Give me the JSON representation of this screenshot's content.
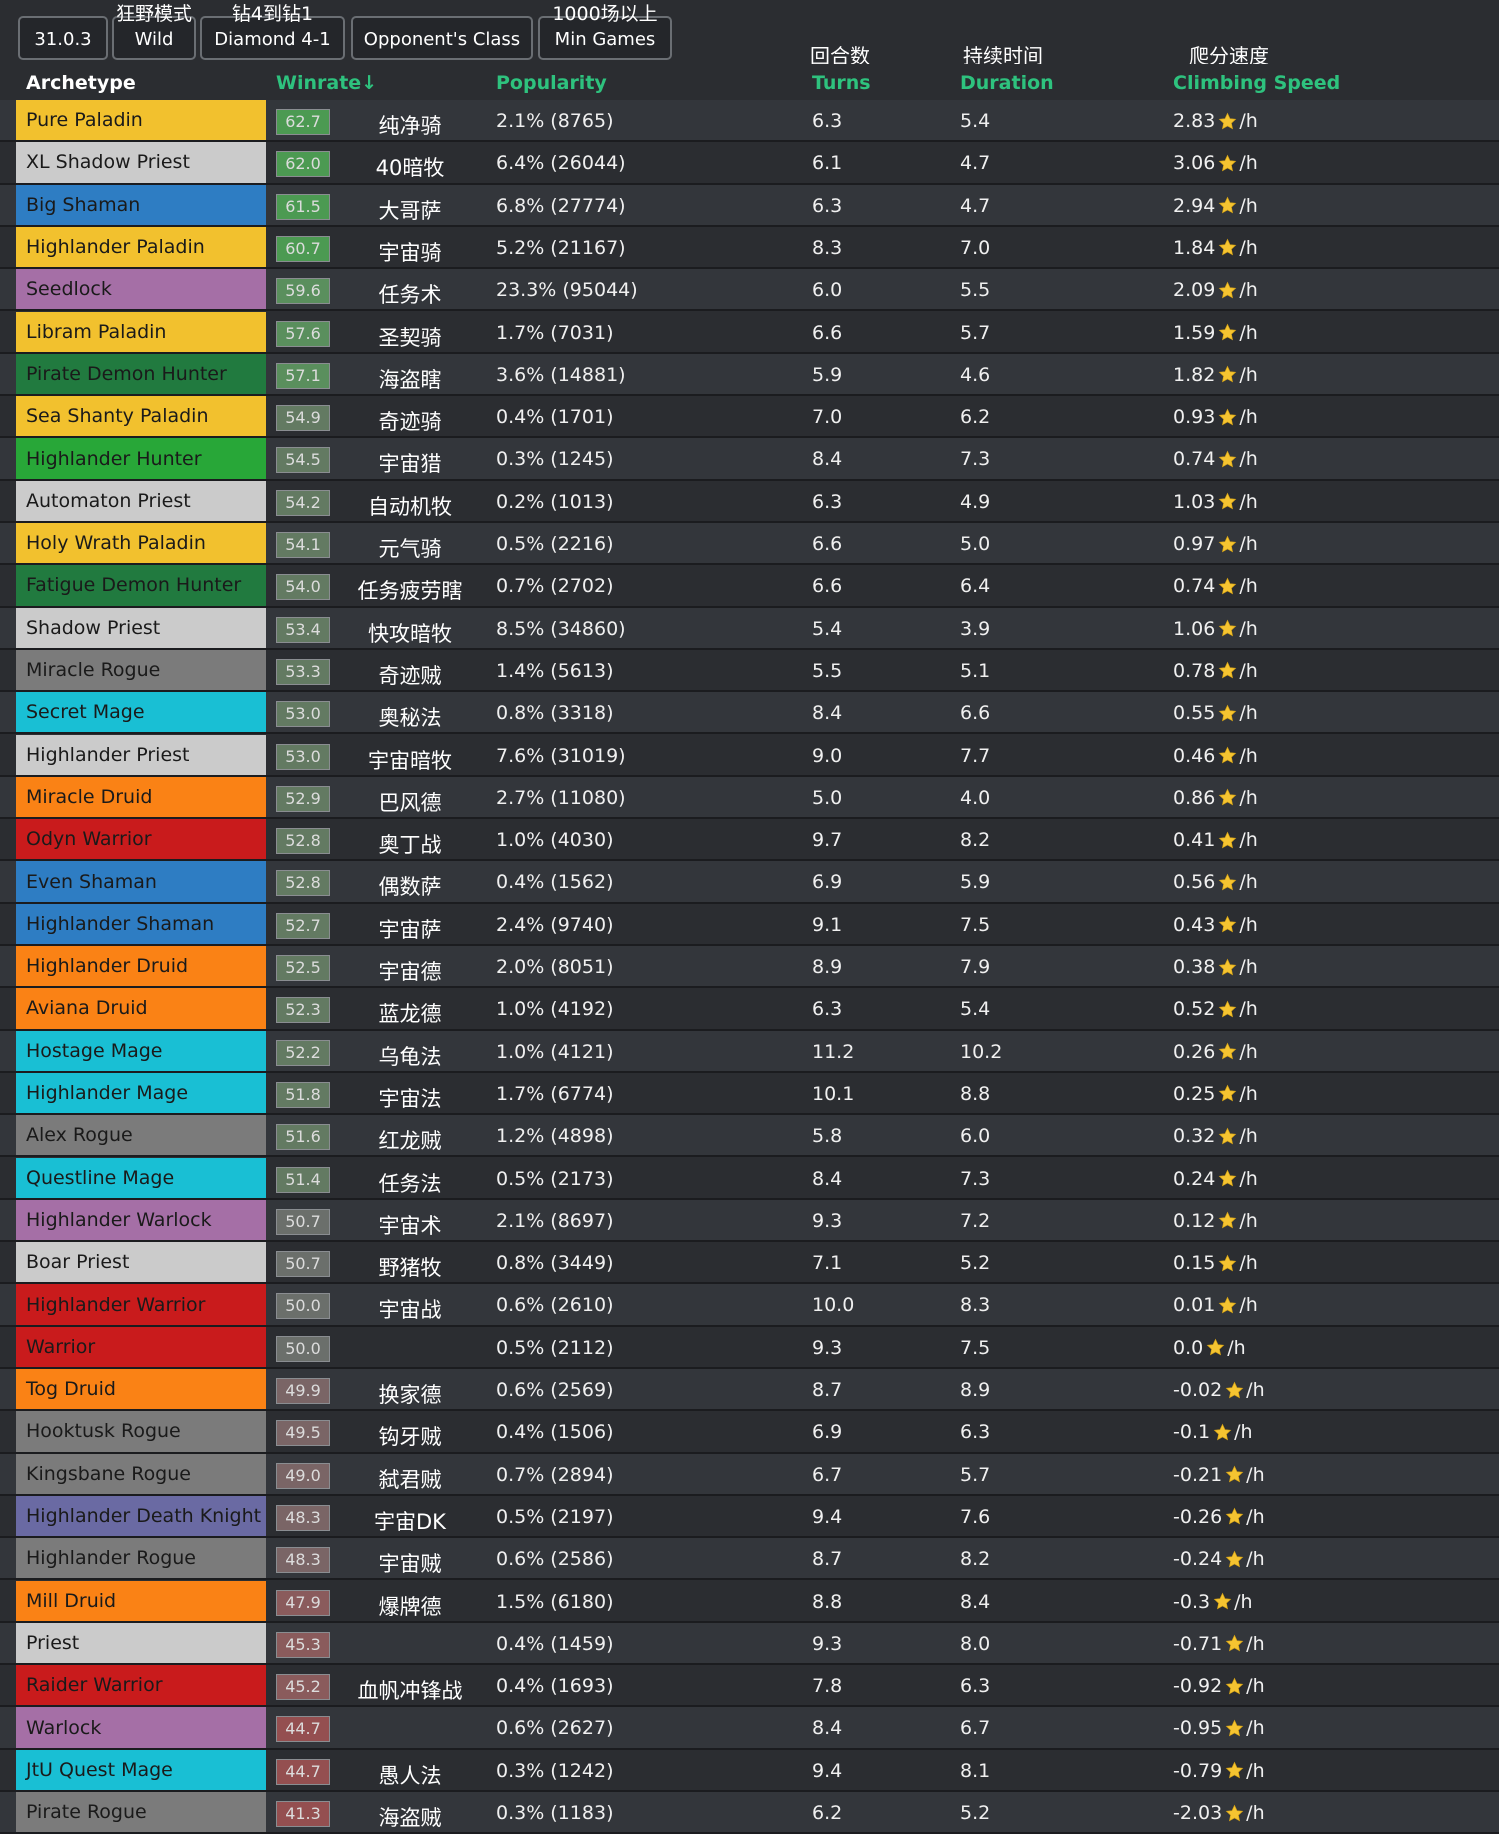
{
  "filters": [
    {
      "cn": "",
      "en": "31.0.3"
    },
    {
      "cn": "狂野模式",
      "en": "Wild"
    },
    {
      "cn": "钻4到钻1",
      "en": "Diamond 4-1"
    },
    {
      "cn": "",
      "en": "Opponent's Class"
    },
    {
      "cn": "1000场以上",
      "en": "Min Games"
    }
  ],
  "header": {
    "archetype": "Archetype",
    "winrate": "Winrate↓",
    "popularity": "Popularity",
    "turns": "Turns",
    "duration": "Duration",
    "climbing": "Climbing Speed",
    "turns_cn": "回合数",
    "duration_cn": "持续时间",
    "climbing_cn": "爬分速度"
  },
  "unit": "/h",
  "class_colors": {
    "paladin": "#f2c12e",
    "priest": "#cbcbcb",
    "shaman": "#2e7dc3",
    "warlock": "#a56fa6",
    "demonhunter": "#217a3f",
    "hunter": "#28a738",
    "rogue": "#7b7b7b",
    "mage": "#19bfd4",
    "druid": "#fa8215",
    "warrior": "#c91b1c",
    "deathknight": "#6a6aa3"
  },
  "rows": [
    {
      "name": "Pure Paladin",
      "cls": "paladin",
      "wr": "62.7",
      "cn": "纯净骑",
      "pop": "2.1% (8765)",
      "turns": "6.3",
      "dur": "5.4",
      "climb": "2.83"
    },
    {
      "name": "XL Shadow Priest",
      "cls": "priest",
      "wr": "62.0",
      "cn": "40暗牧",
      "pop": "6.4% (26044)",
      "turns": "6.1",
      "dur": "4.7",
      "climb": "3.06"
    },
    {
      "name": "Big Shaman",
      "cls": "shaman",
      "wr": "61.5",
      "cn": "大哥萨",
      "pop": "6.8% (27774)",
      "turns": "6.3",
      "dur": "4.7",
      "climb": "2.94"
    },
    {
      "name": "Highlander Paladin",
      "cls": "paladin",
      "wr": "60.7",
      "cn": "宇宙骑",
      "pop": "5.2% (21167)",
      "turns": "8.3",
      "dur": "7.0",
      "climb": "1.84"
    },
    {
      "name": "Seedlock",
      "cls": "warlock",
      "wr": "59.6",
      "cn": "任务术",
      "pop": "23.3% (95044)",
      "turns": "6.0",
      "dur": "5.5",
      "climb": "2.09"
    },
    {
      "name": "Libram Paladin",
      "cls": "paladin",
      "wr": "57.6",
      "cn": "圣契骑",
      "pop": "1.7% (7031)",
      "turns": "6.6",
      "dur": "5.7",
      "climb": "1.59"
    },
    {
      "name": "Pirate Demon Hunter",
      "cls": "demonhunter",
      "wr": "57.1",
      "cn": "海盗瞎",
      "pop": "3.6% (14881)",
      "turns": "5.9",
      "dur": "4.6",
      "climb": "1.82"
    },
    {
      "name": "Sea Shanty Paladin",
      "cls": "paladin",
      "wr": "54.9",
      "cn": "奇迹骑",
      "pop": "0.4% (1701)",
      "turns": "7.0",
      "dur": "6.2",
      "climb": "0.93"
    },
    {
      "name": "Highlander Hunter",
      "cls": "hunter",
      "wr": "54.5",
      "cn": "宇宙猎",
      "pop": "0.3% (1245)",
      "turns": "8.4",
      "dur": "7.3",
      "climb": "0.74"
    },
    {
      "name": "Automaton Priest",
      "cls": "priest",
      "wr": "54.2",
      "cn": "自动机牧",
      "pop": "0.2% (1013)",
      "turns": "6.3",
      "dur": "4.9",
      "climb": "1.03"
    },
    {
      "name": "Holy Wrath Paladin",
      "cls": "paladin",
      "wr": "54.1",
      "cn": "元气骑",
      "pop": "0.5% (2216)",
      "turns": "6.6",
      "dur": "5.0",
      "climb": "0.97"
    },
    {
      "name": "Fatigue Demon Hunter",
      "cls": "demonhunter",
      "wr": "54.0",
      "cn": "任务疲劳瞎",
      "pop": "0.7% (2702)",
      "turns": "6.6",
      "dur": "6.4",
      "climb": "0.74"
    },
    {
      "name": "Shadow Priest",
      "cls": "priest",
      "wr": "53.4",
      "cn": "快攻暗牧",
      "pop": "8.5% (34860)",
      "turns": "5.4",
      "dur": "3.9",
      "climb": "1.06"
    },
    {
      "name": "Miracle Rogue",
      "cls": "rogue",
      "wr": "53.3",
      "cn": "奇迹贼",
      "pop": "1.4% (5613)",
      "turns": "5.5",
      "dur": "5.1",
      "climb": "0.78"
    },
    {
      "name": "Secret Mage",
      "cls": "mage",
      "wr": "53.0",
      "cn": "奥秘法",
      "pop": "0.8% (3318)",
      "turns": "8.4",
      "dur": "6.6",
      "climb": "0.55"
    },
    {
      "name": "Highlander Priest",
      "cls": "priest",
      "wr": "53.0",
      "cn": "宇宙暗牧",
      "pop": "7.6% (31019)",
      "turns": "9.0",
      "dur": "7.7",
      "climb": "0.46"
    },
    {
      "name": "Miracle Druid",
      "cls": "druid",
      "wr": "52.9",
      "cn": "巴风德",
      "pop": "2.7% (11080)",
      "turns": "5.0",
      "dur": "4.0",
      "climb": "0.86"
    },
    {
      "name": "Odyn Warrior",
      "cls": "warrior",
      "wr": "52.8",
      "cn": "奥丁战",
      "pop": "1.0% (4030)",
      "turns": "9.7",
      "dur": "8.2",
      "climb": "0.41"
    },
    {
      "name": "Even Shaman",
      "cls": "shaman",
      "wr": "52.8",
      "cn": "偶数萨",
      "pop": "0.4% (1562)",
      "turns": "6.9",
      "dur": "5.9",
      "climb": "0.56"
    },
    {
      "name": "Highlander Shaman",
      "cls": "shaman",
      "wr": "52.7",
      "cn": "宇宙萨",
      "pop": "2.4% (9740)",
      "turns": "9.1",
      "dur": "7.5",
      "climb": "0.43"
    },
    {
      "name": "Highlander Druid",
      "cls": "druid",
      "wr": "52.5",
      "cn": "宇宙德",
      "pop": "2.0% (8051)",
      "turns": "8.9",
      "dur": "7.9",
      "climb": "0.38"
    },
    {
      "name": "Aviana Druid",
      "cls": "druid",
      "wr": "52.3",
      "cn": "蓝龙德",
      "pop": "1.0% (4192)",
      "turns": "6.3",
      "dur": "5.4",
      "climb": "0.52"
    },
    {
      "name": "Hostage Mage",
      "cls": "mage",
      "wr": "52.2",
      "cn": "乌龟法",
      "pop": "1.0% (4121)",
      "turns": "11.2",
      "dur": "10.2",
      "climb": "0.26"
    },
    {
      "name": "Highlander Mage",
      "cls": "mage",
      "wr": "51.8",
      "cn": "宇宙法",
      "pop": "1.7% (6774)",
      "turns": "10.1",
      "dur": "8.8",
      "climb": "0.25"
    },
    {
      "name": "Alex Rogue",
      "cls": "rogue",
      "wr": "51.6",
      "cn": "红龙贼",
      "pop": "1.2% (4898)",
      "turns": "5.8",
      "dur": "6.0",
      "climb": "0.32"
    },
    {
      "name": "Questline Mage",
      "cls": "mage",
      "wr": "51.4",
      "cn": "任务法",
      "pop": "0.5% (2173)",
      "turns": "8.4",
      "dur": "7.3",
      "climb": "0.24"
    },
    {
      "name": "Highlander Warlock",
      "cls": "warlock",
      "wr": "50.7",
      "cn": "宇宙术",
      "pop": "2.1% (8697)",
      "turns": "9.3",
      "dur": "7.2",
      "climb": "0.12"
    },
    {
      "name": "Boar Priest",
      "cls": "priest",
      "wr": "50.7",
      "cn": "野猪牧",
      "pop": "0.8% (3449)",
      "turns": "7.1",
      "dur": "5.2",
      "climb": "0.15"
    },
    {
      "name": "Highlander Warrior",
      "cls": "warrior",
      "wr": "50.0",
      "cn": "宇宙战",
      "pop": "0.6% (2610)",
      "turns": "10.0",
      "dur": "8.3",
      "climb": "0.01"
    },
    {
      "name": "Warrior",
      "cls": "warrior",
      "wr": "50.0",
      "cn": "",
      "pop": "0.5% (2112)",
      "turns": "9.3",
      "dur": "7.5",
      "climb": "0.0"
    },
    {
      "name": "Tog Druid",
      "cls": "druid",
      "wr": "49.9",
      "cn": "换家德",
      "pop": "0.6% (2569)",
      "turns": "8.7",
      "dur": "8.9",
      "climb": "-0.02"
    },
    {
      "name": "Hooktusk Rogue",
      "cls": "rogue",
      "wr": "49.5",
      "cn": "钩牙贼",
      "pop": "0.4% (1506)",
      "turns": "6.9",
      "dur": "6.3",
      "climb": "-0.1"
    },
    {
      "name": "Kingsbane Rogue",
      "cls": "rogue",
      "wr": "49.0",
      "cn": "弑君贼",
      "pop": "0.7% (2894)",
      "turns": "6.7",
      "dur": "5.7",
      "climb": "-0.21"
    },
    {
      "name": "Highlander Death Knight",
      "cls": "deathknight",
      "wr": "48.3",
      "cn": "宇宙DK",
      "pop": "0.5% (2197)",
      "turns": "9.4",
      "dur": "7.6",
      "climb": "-0.26"
    },
    {
      "name": "Highlander Rogue",
      "cls": "rogue",
      "wr": "48.3",
      "cn": "宇宙贼",
      "pop": "0.6% (2586)",
      "turns": "8.7",
      "dur": "8.2",
      "climb": "-0.24"
    },
    {
      "name": "Mill Druid",
      "cls": "druid",
      "wr": "47.9",
      "cn": "爆牌德",
      "pop": "1.5% (6180)",
      "turns": "8.8",
      "dur": "8.4",
      "climb": "-0.3"
    },
    {
      "name": "Priest",
      "cls": "priest",
      "wr": "45.3",
      "cn": "",
      "pop": "0.4% (1459)",
      "turns": "9.3",
      "dur": "8.0",
      "climb": "-0.71"
    },
    {
      "name": "Raider Warrior",
      "cls": "warrior",
      "wr": "45.2",
      "cn": "血帆冲锋战",
      "pop": "0.4% (1693)",
      "turns": "7.8",
      "dur": "6.3",
      "climb": "-0.92"
    },
    {
      "name": "Warlock",
      "cls": "warlock",
      "wr": "44.7",
      "cn": "",
      "pop": "0.6% (2627)",
      "turns": "8.4",
      "dur": "6.7",
      "climb": "-0.95"
    },
    {
      "name": "JtU Quest Mage",
      "cls": "mage",
      "wr": "44.7",
      "cn": "愚人法",
      "pop": "0.3% (1242)",
      "turns": "9.4",
      "dur": "8.1",
      "climb": "-0.79"
    },
    {
      "name": "Pirate Rogue",
      "cls": "rogue",
      "wr": "41.3",
      "cn": "海盗贼",
      "pop": "0.3% (1183)",
      "turns": "6.2",
      "dur": "5.2",
      "climb": "-2.03"
    }
  ]
}
